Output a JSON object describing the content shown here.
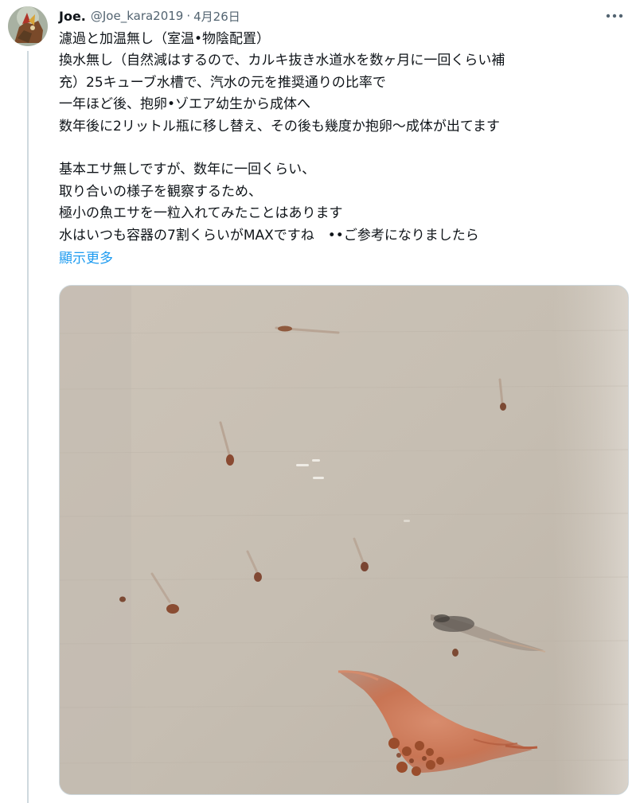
{
  "tweet": {
    "display_name": "Joe.",
    "handle": "@Joe_kara2019",
    "separator": "·",
    "date": "4月26日",
    "lines": [
      "濾過と加温無し（室温•物陰配置）",
      "換水無し（自然減はするので、カルキ抜き水道水を数ヶ月に一回くらい補",
      "充）25キューブ水槽で、汽水の元を推奨通りの比率で",
      "一年ほど後、抱卵•ゾエア幼生から成体へ",
      "数年後に2リットル瓶に移し替え、その後も幾度か抱卵〜成体が出てます",
      "",
      "基本エサ無しですが、数年に一回くらい、",
      "取り合いの様子を観察するため、",
      "極小の魚エサを一粒入れてみたことはあります",
      "水はいつも容器の7割くらいがMAXですね　••ご参考になりましたら"
    ],
    "show_more_label": "顯示更多",
    "more_icon": "more-dots-icon",
    "media_icon": "shrimp-photo"
  },
  "colors": {
    "text": "#0f1419",
    "secondary": "#536471",
    "link": "#1d9bf0",
    "thread_line": "#cfd9de",
    "photo_background": "#c9c0b4"
  }
}
